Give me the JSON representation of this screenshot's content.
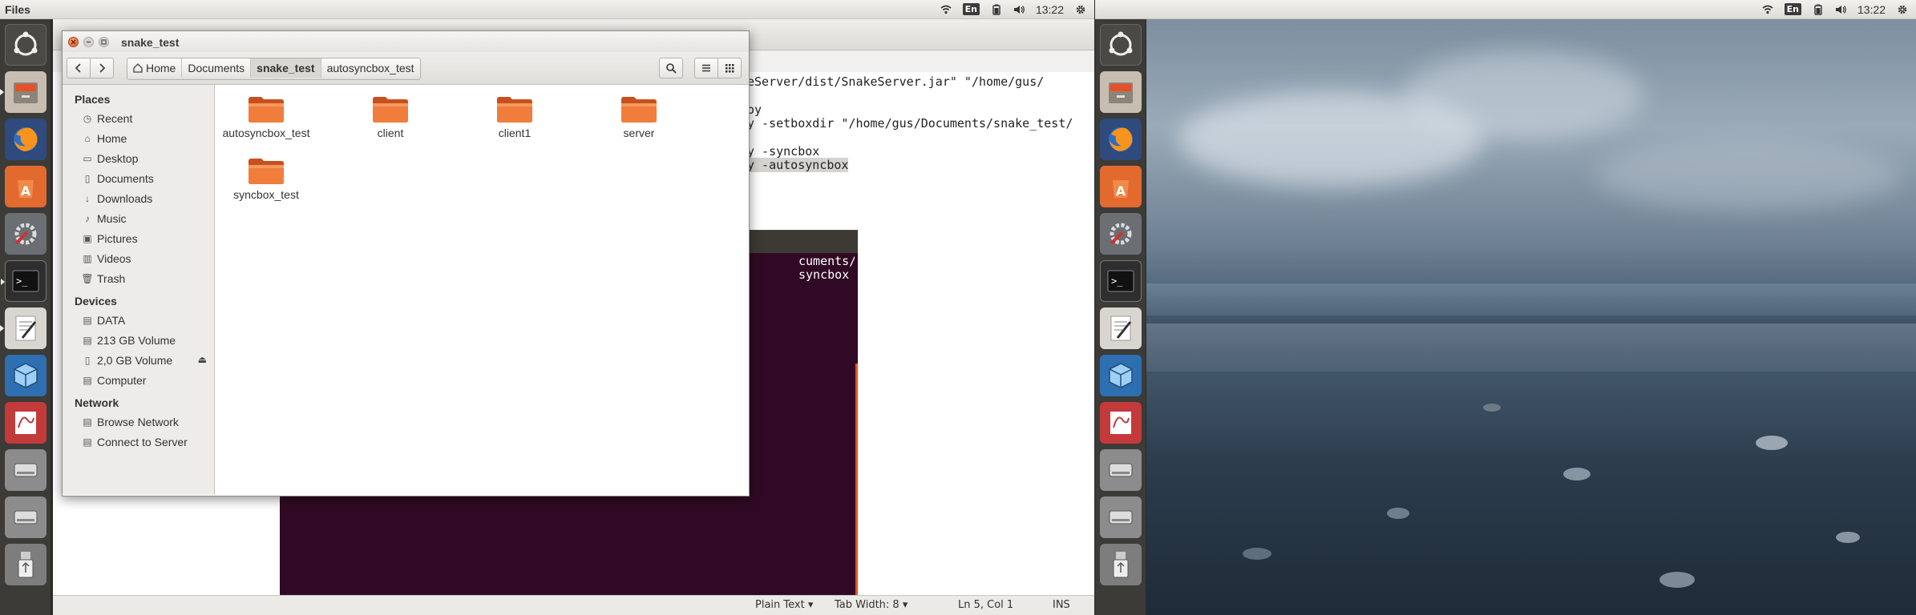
{
  "left_panel": {
    "app_title": "Files",
    "time": "13:22",
    "keyboard": "En"
  },
  "right_panel": {
    "time": "13:22",
    "keyboard": "En"
  },
  "launcher_icons": [
    "dash-icon",
    "files-icon",
    "firefox-icon",
    "software-center-icon",
    "system-settings-icon",
    "terminal-icon",
    "text-editor-icon",
    "virtualbox-icon",
    "document-viewer-icon",
    "drive-icon",
    "drive-icon",
    "usb-drive-icon"
  ],
  "gedit": {
    "lines": [
      "eServer/dist/SnakeServer.jar\" \"/home/gus/",
      "oy",
      "y -setboxdir \"/home/gus/Documents/snake_test/",
      "",
      "y -syncbox",
      "y -autosyncbox"
    ],
    "status": {
      "language": "Plain Text ▾",
      "tab_width": "Tab Width: 8 ▾",
      "position": "Ln 5, Col 1",
      "mode": "INS"
    }
  },
  "terminal": {
    "lines": [
      "cuments/",
      "syncbox"
    ]
  },
  "files": {
    "title": "snake_test",
    "breadcrumbs": [
      "Home",
      "Documents",
      "snake_test",
      "autosyncbox_test"
    ],
    "sidebar": {
      "places_heading": "Places",
      "places": [
        {
          "label": "Recent",
          "icon": "recent-icon",
          "glyph": "◷"
        },
        {
          "label": "Home",
          "icon": "home-icon",
          "glyph": "⌂"
        },
        {
          "label": "Desktop",
          "icon": "desktop-icon",
          "glyph": "▭"
        },
        {
          "label": "Documents",
          "icon": "documents-icon",
          "glyph": "▯"
        },
        {
          "label": "Downloads",
          "icon": "downloads-icon",
          "glyph": "↓"
        },
        {
          "label": "Music",
          "icon": "music-icon",
          "glyph": "♪"
        },
        {
          "label": "Pictures",
          "icon": "pictures-icon",
          "glyph": "▣"
        },
        {
          "label": "Videos",
          "icon": "videos-icon",
          "glyph": "▥"
        },
        {
          "label": "Trash",
          "icon": "trash-icon",
          "glyph": "🗑"
        }
      ],
      "devices_heading": "Devices",
      "devices": [
        {
          "label": "DATA",
          "icon": "drive-icon",
          "glyph": "▤"
        },
        {
          "label": "213 GB Volume",
          "icon": "drive-icon",
          "glyph": "▤"
        },
        {
          "label": "2,0 GB Volume",
          "icon": "usb-icon",
          "glyph": "▯",
          "eject": "⏏"
        },
        {
          "label": "Computer",
          "icon": "computer-icon",
          "glyph": "▤"
        }
      ],
      "network_heading": "Network",
      "network": [
        {
          "label": "Browse Network",
          "icon": "network-icon",
          "glyph": "▤"
        },
        {
          "label": "Connect to Server",
          "icon": "server-icon",
          "glyph": "▤"
        }
      ]
    },
    "folders": [
      "autosyncbox_test",
      "client",
      "client1",
      "server",
      "syncbox_test"
    ]
  }
}
